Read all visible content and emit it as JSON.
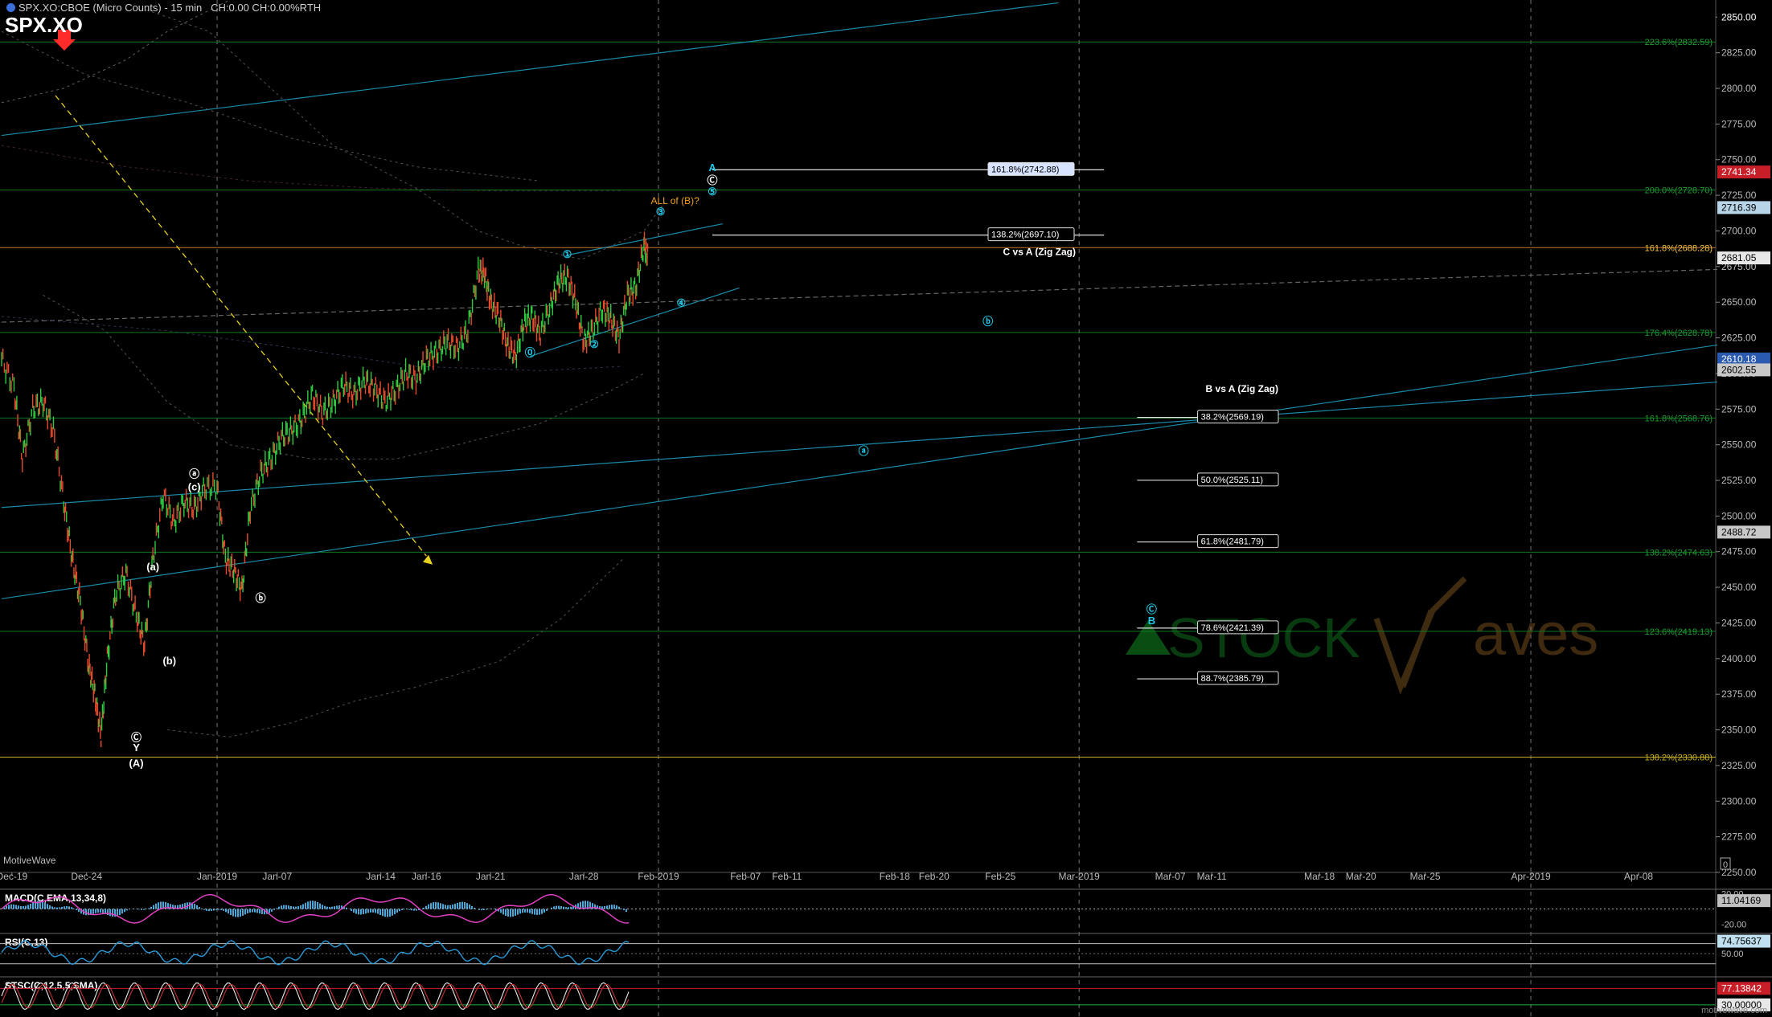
{
  "header": {
    "title": "SPX.XO:CBOE (Micro Counts) - 15 min",
    "stats": "CH:0.00 CH:0.00%RTH",
    "symbol": "SPX.XO",
    "brand": "MotiveWave",
    "watermark_left": "STOCK",
    "watermark_right": "aves",
    "site": "motivewave.com"
  },
  "colors": {
    "background": "#000000",
    "grid": "#2a2a2a",
    "fib_line": "#0e7a1e",
    "fib_label": "#1f9a33",
    "channel": "#1a8aa8",
    "wave_label": "#20c8e8",
    "price_bar_up": "#2ecc40",
    "price_bar_down": "#e84a2c",
    "accent_orange": "#f0a020",
    "yellow_arrow": "#e8d020",
    "red_arrow": "#ff2a2a"
  },
  "chart_data": [
    {
      "type": "line",
      "name": "main",
      "ylim": [
        2250,
        2862
      ],
      "y_ticks": [
        2250,
        2275,
        2300,
        2325,
        2350,
        2375,
        2400,
        2425,
        2450,
        2475,
        2500,
        2525,
        2550,
        2575,
        2600,
        2625,
        2650,
        2675,
        2700,
        2725,
        2750,
        2775,
        2800,
        2825,
        2850
      ],
      "x_ticks": [
        {
          "label": "Dec-19",
          "bar": 0.5
        },
        {
          "label": "Dec-24",
          "bar": 4.1
        },
        {
          "label": "Jan-2019",
          "bar": 10.4
        },
        {
          "label": "Jan-07",
          "bar": 13.3
        },
        {
          "label": "Jan-14",
          "bar": 18.3
        },
        {
          "label": "Jan-16",
          "bar": 20.5
        },
        {
          "label": "Jan-21",
          "bar": 23.6
        },
        {
          "label": "Jan-28",
          "bar": 28.1
        },
        {
          "label": "Feb-2019",
          "bar": 31.7
        },
        {
          "label": "Feb-07",
          "bar": 35.9
        },
        {
          "label": "Feb-11",
          "bar": 37.9
        },
        {
          "label": "Feb-18",
          "bar": 43.1
        },
        {
          "label": "Feb-20",
          "bar": 45.0
        },
        {
          "label": "Feb-25",
          "bar": 48.2
        },
        {
          "label": "Mar-2019",
          "bar": 52.0
        },
        {
          "label": "Mar-07",
          "bar": 56.4
        },
        {
          "label": "Mar-11",
          "bar": 58.4
        },
        {
          "label": "Mar-18",
          "bar": 63.6
        },
        {
          "label": "Mar-20",
          "bar": 65.6
        },
        {
          "label": "Mar-25",
          "bar": 68.7
        },
        {
          "label": "Apr-2019",
          "bar": 73.8
        },
        {
          "label": "Apr-08",
          "bar": 79.0
        }
      ],
      "price_path": [
        [
          0,
          2610
        ],
        [
          0.6,
          2590
        ],
        [
          1,
          2540
        ],
        [
          1.5,
          2575
        ],
        [
          2,
          2580
        ],
        [
          2.5,
          2560
        ],
        [
          3,
          2510
        ],
        [
          3.4,
          2470
        ],
        [
          3.8,
          2440
        ],
        [
          4.2,
          2395
        ],
        [
          4.5,
          2375
        ],
        [
          4.8,
          2346
        ],
        [
          5.1,
          2400
        ],
        [
          5.5,
          2445
        ],
        [
          6,
          2460
        ],
        [
          6.5,
          2430
        ],
        [
          6.9,
          2410
        ],
        [
          7.3,
          2470
        ],
        [
          7.8,
          2515
        ],
        [
          8.3,
          2495
        ],
        [
          8.8,
          2510
        ],
        [
          9.3,
          2505
        ],
        [
          9.8,
          2520
        ],
        [
          10.4,
          2520
        ],
        [
          10.8,
          2470
        ],
        [
          11.2,
          2462
        ],
        [
          11.6,
          2448
        ],
        [
          12,
          2505
        ],
        [
          12.5,
          2530
        ],
        [
          13,
          2540
        ],
        [
          13.5,
          2555
        ],
        [
          14,
          2560
        ],
        [
          14.5,
          2568
        ],
        [
          15,
          2585
        ],
        [
          15.5,
          2572
        ],
        [
          16,
          2580
        ],
        [
          16.5,
          2592
        ],
        [
          17,
          2585
        ],
        [
          17.5,
          2595
        ],
        [
          18,
          2590
        ],
        [
          18.5,
          2580
        ],
        [
          19,
          2588
        ],
        [
          19.5,
          2600
        ],
        [
          20,
          2596
        ],
        [
          20.5,
          2610
        ],
        [
          21,
          2615
        ],
        [
          21.5,
          2622
        ],
        [
          22,
          2618
        ],
        [
          22.5,
          2630
        ],
        [
          23,
          2672
        ],
        [
          23.3,
          2670
        ],
        [
          23.6,
          2650
        ],
        [
          24,
          2640
        ],
        [
          24.4,
          2620
        ],
        [
          24.8,
          2612
        ],
        [
          25.2,
          2635
        ],
        [
          25.6,
          2640
        ],
        [
          26,
          2628
        ],
        [
          26.5,
          2648
        ],
        [
          26.9,
          2665
        ],
        [
          27.3,
          2668
        ],
        [
          27.7,
          2650
        ],
        [
          28.1,
          2622
        ],
        [
          28.5,
          2630
        ],
        [
          29,
          2645
        ],
        [
          29.4,
          2638
        ],
        [
          29.8,
          2625
        ],
        [
          30.2,
          2655
        ],
        [
          30.6,
          2660
        ],
        [
          31,
          2690
        ],
        [
          31.2,
          2682
        ]
      ],
      "fib_levels": [
        {
          "label": "223.6%(2832.59)",
          "value": 2832.59
        },
        {
          "label": "200.0%(2728.70)",
          "value": 2728.7
        },
        {
          "label": "161.8%(2688.28)",
          "value": 2688.28
        },
        {
          "label": "176.4%(2628.78)",
          "value": 2628.78
        },
        {
          "label": "161.8%(2568.76)",
          "value": 2568.76
        },
        {
          "label": "138.2%(2474.63)",
          "value": 2474.63
        },
        {
          "label": "123.6%(2419.13)",
          "value": 2419.13
        },
        {
          "label": "138.2%(2330.88)",
          "value": 2330.88
        }
      ],
      "targets": [
        {
          "label": "161.8%(2742.88)",
          "value": 2742.88,
          "bar_from": 34.3,
          "bar_to": 53.2
        },
        {
          "label": "138.2%(2697.10)",
          "value": 2697.1,
          "bar_from": 34.3,
          "bar_to": 53.2
        }
      ],
      "retracement_title": "B vs A (Zig Zag)",
      "retracement_title_2": "C vs A (Zig Zag)",
      "retracements": [
        {
          "label": "38.2%(2569.19)",
          "value": 2569.19
        },
        {
          "label": "50.0%(2525.11)",
          "value": 2525.11
        },
        {
          "label": "61.8%(2481.79)",
          "value": 2481.79
        },
        {
          "label": "78.6%(2421.39)",
          "value": 2421.39
        },
        {
          "label": "88.7%(2385.79)",
          "value": 2385.79
        }
      ],
      "price_badges": [
        {
          "value": 2850.0,
          "text": "2850.00",
          "color": "#ffffff",
          "bg": "#000000"
        },
        {
          "value": 2741.34,
          "text": "2741.34",
          "color": "#ffffff",
          "bg": "#c81e28"
        },
        {
          "value": 2716.39,
          "text": "2716.39",
          "color": "#000000",
          "bg": "#b8d4e8"
        },
        {
          "value": 2681.05,
          "text": "2681.05",
          "color": "#000000",
          "bg": "#e8e8e8"
        },
        {
          "value": 2610.18,
          "text": "2610.18",
          "color": "#ffffff",
          "bg": "#2a5ab0"
        },
        {
          "value": 2602.55,
          "text": "2602.55",
          "color": "#000000",
          "bg": "#c8c8c8"
        },
        {
          "value": 2488.72,
          "text": "2488.72",
          "color": "#000000",
          "bg": "#c8c8c8"
        }
      ],
      "wave_labels": [
        {
          "text": "ⓐ",
          "bar": 9.3,
          "value": 2527,
          "color": "#ffffff"
        },
        {
          "text": "(c)",
          "bar": 9.3,
          "value": 2518,
          "color": "#ffffff"
        },
        {
          "text": "(a)",
          "bar": 7.3,
          "value": 2462,
          "color": "#ffffff"
        },
        {
          "text": "ⓑ",
          "bar": 12.5,
          "value": 2440,
          "color": "#ffffff"
        },
        {
          "text": "(b)",
          "bar": 8.1,
          "value": 2396,
          "color": "#ffffff"
        },
        {
          "text": "Ⓒ",
          "bar": 6.5,
          "value": 2342,
          "color": "#ffffff"
        },
        {
          "text": "Y",
          "bar": 6.5,
          "value": 2335,
          "color": "#ffffff"
        },
        {
          "text": "(A)",
          "bar": 6.5,
          "value": 2324,
          "color": "#ffffff"
        },
        {
          "text": "①",
          "bar": 27.3,
          "value": 2681,
          "color": "#20c8e8"
        },
        {
          "text": "②",
          "bar": 28.6,
          "value": 2618,
          "color": "#20c8e8"
        },
        {
          "text": "③",
          "bar": 31.8,
          "value": 2711,
          "color": "#20c8e8"
        },
        {
          "text": "④",
          "bar": 32.8,
          "value": 2647,
          "color": "#20c8e8"
        },
        {
          "text": "⑤",
          "bar": 34.3,
          "value": 2725,
          "color": "#20c8e8"
        },
        {
          "text": "⓪",
          "bar": 25.5,
          "value": 2612,
          "color": "#20c8e8"
        },
        {
          "text": "Ⓒ",
          "bar": 34.3,
          "value": 2733,
          "color": "#ffffff"
        },
        {
          "text": "A",
          "bar": 34.3,
          "value": 2742,
          "color": "#20c8e8"
        },
        {
          "text": "ⓑ",
          "bar": 47.6,
          "value": 2634,
          "color": "#20c8e8"
        },
        {
          "text": "ⓐ",
          "bar": 41.6,
          "value": 2543,
          "color": "#20c8e8"
        },
        {
          "text": "Ⓒ",
          "bar": 55.5,
          "value": 2432,
          "color": "#20c8e8"
        },
        {
          "text": "B",
          "bar": 55.5,
          "value": 2424,
          "color": "#20c8e8"
        },
        {
          "text": "ALL of (B)?",
          "bar": 32.5,
          "value": 2719,
          "color": "#f0a020"
        }
      ]
    },
    {
      "type": "line",
      "name": "MACD(C,EMA,13,34,8)",
      "ylim": [
        -28,
        26
      ],
      "y_ticks": [
        20,
        -20
      ],
      "badge": {
        "text": "11.04169",
        "value": 11.04,
        "color": "#000000",
        "bg": "#c0c0c0"
      }
    },
    {
      "type": "line",
      "name": "RSI(C,13)",
      "ylim": [
        20,
        90
      ],
      "y_ticks": [
        50
      ],
      "badge": {
        "text": "74.75637",
        "value": 74.76,
        "color": "#000000",
        "bg": "#c0e0f0"
      }
    },
    {
      "type": "line",
      "name": "STSC(C,12,5,5,SMA)",
      "ylim": [
        0,
        110
      ],
      "y_ticks": [],
      "badges": [
        {
          "text": "77.13842",
          "value": 77.14,
          "color": "#ffffff",
          "bg": "#c81e28"
        },
        {
          "text": "30.00000",
          "value": 30.0,
          "color": "#000000",
          "bg": "#e8e8e8"
        }
      ]
    }
  ]
}
